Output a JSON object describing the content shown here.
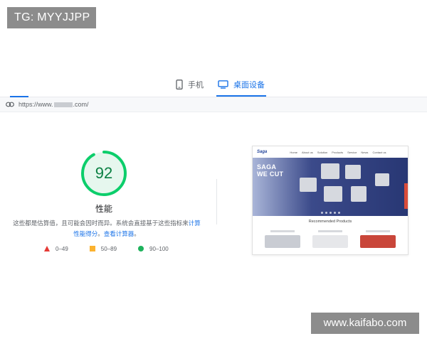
{
  "watermarks": {
    "top_left": "TG: MYYJJPP",
    "bottom_right": "www.kaifabo.com"
  },
  "device_tabs": {
    "mobile": {
      "label": "手机",
      "icon": "phone-icon",
      "selected": false
    },
    "desktop": {
      "label": "桌面设备",
      "icon": "monitor-icon",
      "selected": true
    }
  },
  "url_bar": {
    "icon": "link-icon",
    "prefix": "https://www.",
    "suffix": ".com/"
  },
  "score": {
    "value": 92,
    "value_text": "92",
    "label": "性能",
    "color": "#0cce6b"
  },
  "description": {
    "text": "这些都是估算值，且可能会因时而异。系统会直接基于这些指标来",
    "link1": "计算性能得分",
    "middle": "。",
    "link2": "查看计算器",
    "end": "。"
  },
  "legend": [
    {
      "shape": "triangle",
      "label": "0–49",
      "color": "#e53935"
    },
    {
      "shape": "square",
      "label": "50–89",
      "color": "#fbb22f"
    },
    {
      "shape": "circle",
      "label": "90–100",
      "color": "#1eb25c"
    }
  ],
  "preview": {
    "logo": "Saga",
    "nav": [
      "Home",
      "About us",
      "Solution",
      "Products",
      "Service",
      "News",
      "Contact us"
    ],
    "brand_line1": "SAGA",
    "brand_line2": "WE CUT",
    "section_title": "Recommended Products"
  },
  "colors": {
    "accent": "#1a73e8",
    "pass": "#0cce6b",
    "average": "#fbb22f",
    "fail": "#e53935"
  }
}
